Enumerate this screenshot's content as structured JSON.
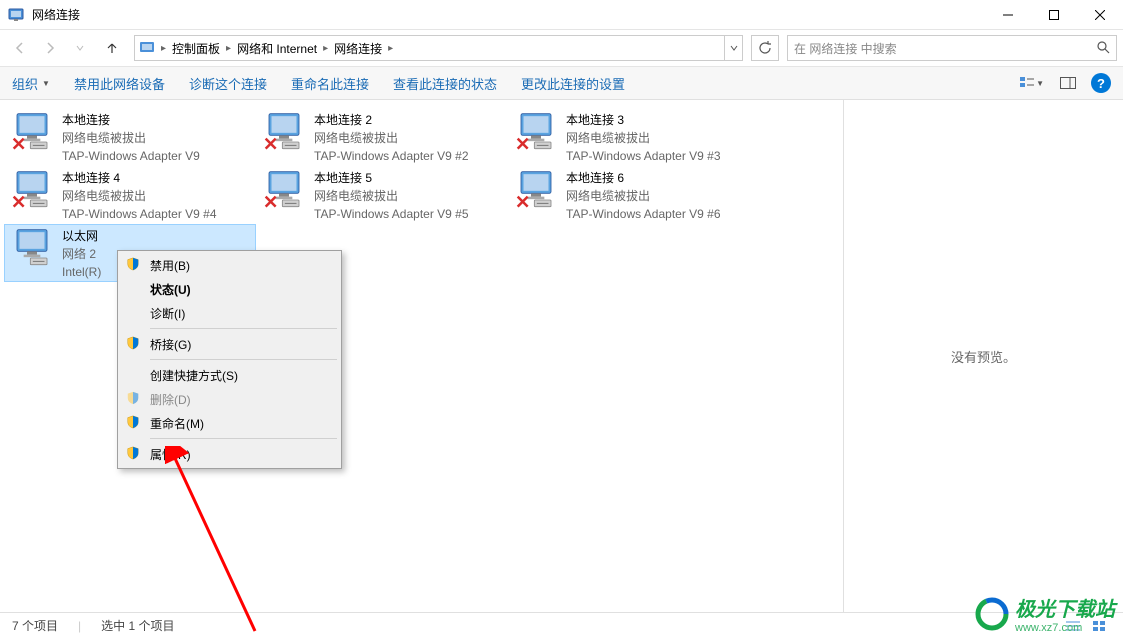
{
  "window": {
    "title": "网络连接"
  },
  "breadcrumb": {
    "items": [
      "控制面板",
      "网络和 Internet",
      "网络连接"
    ]
  },
  "search": {
    "placeholder": "在 网络连接 中搜索"
  },
  "toolbar": {
    "organize": "组织",
    "disable": "禁用此网络设备",
    "diagnose": "诊断这个连接",
    "rename": "重命名此连接",
    "status": "查看此连接的状态",
    "settings": "更改此连接的设置"
  },
  "connections": [
    {
      "name": "本地连接",
      "status": "网络电缆被拔出",
      "device": "TAP-Windows Adapter V9",
      "disconnected": true
    },
    {
      "name": "本地连接 2",
      "status": "网络电缆被拔出",
      "device": "TAP-Windows Adapter V9 #2",
      "disconnected": true
    },
    {
      "name": "本地连接 3",
      "status": "网络电缆被拔出",
      "device": "TAP-Windows Adapter V9 #3",
      "disconnected": true
    },
    {
      "name": "本地连接 4",
      "status": "网络电缆被拔出",
      "device": "TAP-Windows Adapter V9 #4",
      "disconnected": true
    },
    {
      "name": "本地连接 5",
      "status": "网络电缆被拔出",
      "device": "TAP-Windows Adapter V9 #5",
      "disconnected": true
    },
    {
      "name": "本地连接 6",
      "status": "网络电缆被拔出",
      "device": "TAP-Windows Adapter V9 #6",
      "disconnected": true
    },
    {
      "name": "以太网",
      "status": "网络 2",
      "device": "Intel(R)",
      "disconnected": false,
      "selected": true
    }
  ],
  "context_menu": {
    "disable": "禁用(B)",
    "status": "状态(U)",
    "diagnose": "诊断(I)",
    "bridge": "桥接(G)",
    "shortcut": "创建快捷方式(S)",
    "delete": "删除(D)",
    "rename": "重命名(M)",
    "properties": "属性(R)"
  },
  "preview": {
    "no_preview": "没有预览。"
  },
  "statusbar": {
    "total": "7 个项目",
    "selected": "选中 1 个项目"
  },
  "watermark": {
    "brand": "极光下载站",
    "url": "www.xz7.com"
  }
}
